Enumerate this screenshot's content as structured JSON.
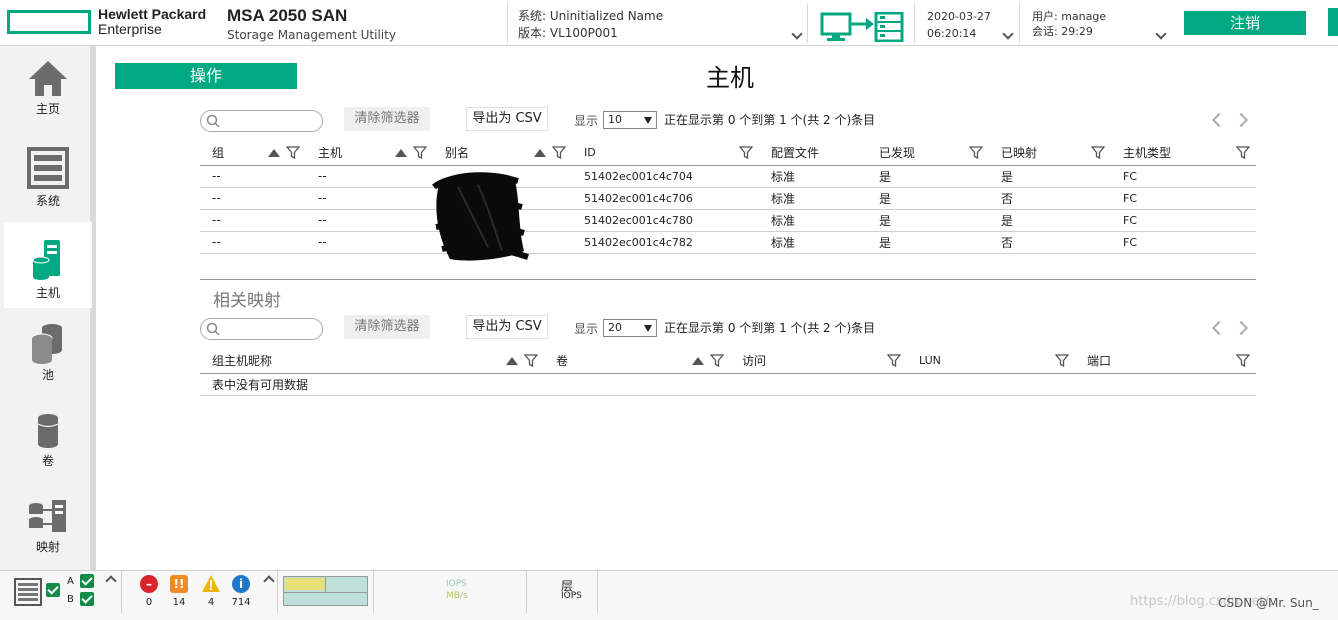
{
  "header": {
    "brand_line1": "Hewlett Packard",
    "brand_line2": "Enterprise",
    "product_name": "MSA 2050 SAN",
    "product_sub": "Storage Management Utility",
    "system_line": "系统: Uninitialized Name",
    "version_line": "版本: VL100P001",
    "date": "2020-03-27",
    "time": "06:20:14",
    "user_line": "用户: manage",
    "session_line": "会话: 29:29",
    "logout_label": "注销",
    "accent_color": "#01a982"
  },
  "sidebar": {
    "items": [
      {
        "label": "主页",
        "icon": "home-icon"
      },
      {
        "label": "系统",
        "icon": "system-icon"
      },
      {
        "label": "主机",
        "icon": "hosts-icon",
        "active": true
      },
      {
        "label": "池",
        "icon": "pools-icon"
      },
      {
        "label": "卷",
        "icon": "volumes-icon"
      },
      {
        "label": "映射",
        "icon": "mapping-icon"
      }
    ]
  },
  "main": {
    "ops_label": "操作",
    "title": "主机",
    "hosts_table": {
      "search_placeholder": "",
      "clear_label": "清除筛选器",
      "export_label": "导出为 CSV",
      "show_label": "显示",
      "page_size": "10",
      "status": "正在显示第 0 个到第 1 个(共 2 个)条目",
      "columns": [
        "组",
        "主机",
        "别名",
        "ID",
        "配置文件",
        "已发现",
        "已映射",
        "主机类型"
      ],
      "rows": [
        {
          "group": "--",
          "host": "--",
          "alias": "",
          "id": "51402ec001c4c704",
          "profile": "标准",
          "discovered": "是",
          "mapped": "是",
          "type": "FC"
        },
        {
          "group": "--",
          "host": "--",
          "alias": "",
          "id": "51402ec001c4c706",
          "profile": "标准",
          "discovered": "是",
          "mapped": "否",
          "type": "FC"
        },
        {
          "group": "--",
          "host": "--",
          "alias": "",
          "id": "51402ec001c4c780",
          "profile": "标准",
          "discovered": "是",
          "mapped": "是",
          "type": "FC"
        },
        {
          "group": "--",
          "host": "--",
          "alias": "",
          "id": "51402ec001c4c782",
          "profile": "标准",
          "discovered": "是",
          "mapped": "否",
          "type": "FC"
        }
      ]
    },
    "mappings": {
      "title": "相关映射",
      "clear_label": "清除筛选器",
      "export_label": "导出为 CSV",
      "show_label": "显示",
      "page_size": "20",
      "status": "正在显示第 0 个到第 1 个(共 2 个)条目",
      "columns": [
        "组主机昵称",
        "卷",
        "访问",
        "LUN",
        "端口"
      ],
      "empty_text": "表中没有可用数据"
    }
  },
  "footer": {
    "ctrl_a": "A",
    "ctrl_b": "B",
    "alerts": [
      {
        "kind": "critical",
        "count": "0",
        "color": "#d9262b",
        "icon": "no-entry-icon"
      },
      {
        "kind": "error",
        "count": "14",
        "color": "#f08a24",
        "icon": "error-icon"
      },
      {
        "kind": "warning",
        "count": "4",
        "color": "#f2b705",
        "icon": "warning-icon"
      },
      {
        "kind": "info",
        "count": "714",
        "color": "#1f77c9",
        "icon": "info-icon"
      }
    ],
    "iops_label": "IOPS",
    "mbs_label": "MB/s",
    "tier_label": "层",
    "tier_sub": "IOPS",
    "watermark": "https://blog.csdn.net/...",
    "csdn_credit": "CSDN @Mr. Sun_"
  }
}
